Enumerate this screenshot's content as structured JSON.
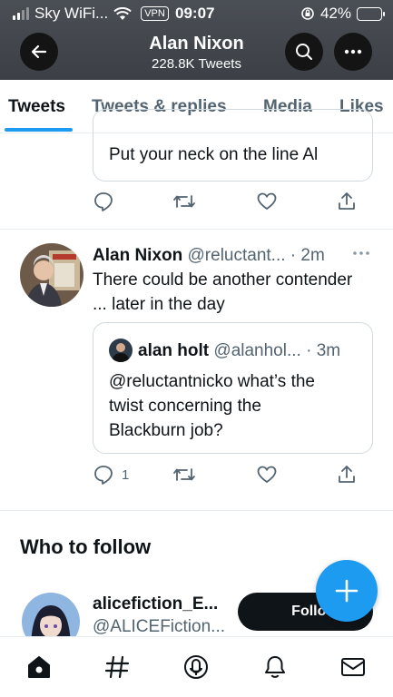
{
  "status_bar": {
    "carrier": "Sky WiFi...",
    "vpn": "VPN",
    "time": "09:07",
    "battery": "42%",
    "battery_color": "#65d33a"
  },
  "header": {
    "title": "Alan Nixon",
    "subtitle": "228.8K Tweets",
    "back_icon": "arrow-left-icon",
    "search_icon": "search-icon",
    "more_icon": "more-icon"
  },
  "tabs": [
    {
      "label": "Tweets",
      "active": true
    },
    {
      "label": "Tweets & replies",
      "active": false
    },
    {
      "label": "Media",
      "active": false
    },
    {
      "label": "Likes",
      "active": false
    }
  ],
  "tweet_top": {
    "quote_text": "Put your neck on the line Al"
  },
  "tweet_main": {
    "name": "Alan Nixon",
    "handle_time": "@reluctant... · 2m",
    "text_line1": "There could be another contender",
    "text_line2": "... later in the day",
    "quote": {
      "name": "alan holt",
      "handle_time": "@alanhol... · 3m",
      "line1": "@reluctantnicko what’s the",
      "line2": "twist concerning the",
      "line3": "Blackburn job?"
    },
    "reply_count": "1"
  },
  "who_to_follow": {
    "title": "Who to follow",
    "name": "alicefiction_E...",
    "handle": "@ALICEFiction...",
    "follow_label": "Follow"
  },
  "accent_color": "#1d9bf0",
  "nav": [
    "home-icon",
    "explore-icon",
    "spaces-icon",
    "notifications-icon",
    "messages-icon"
  ]
}
